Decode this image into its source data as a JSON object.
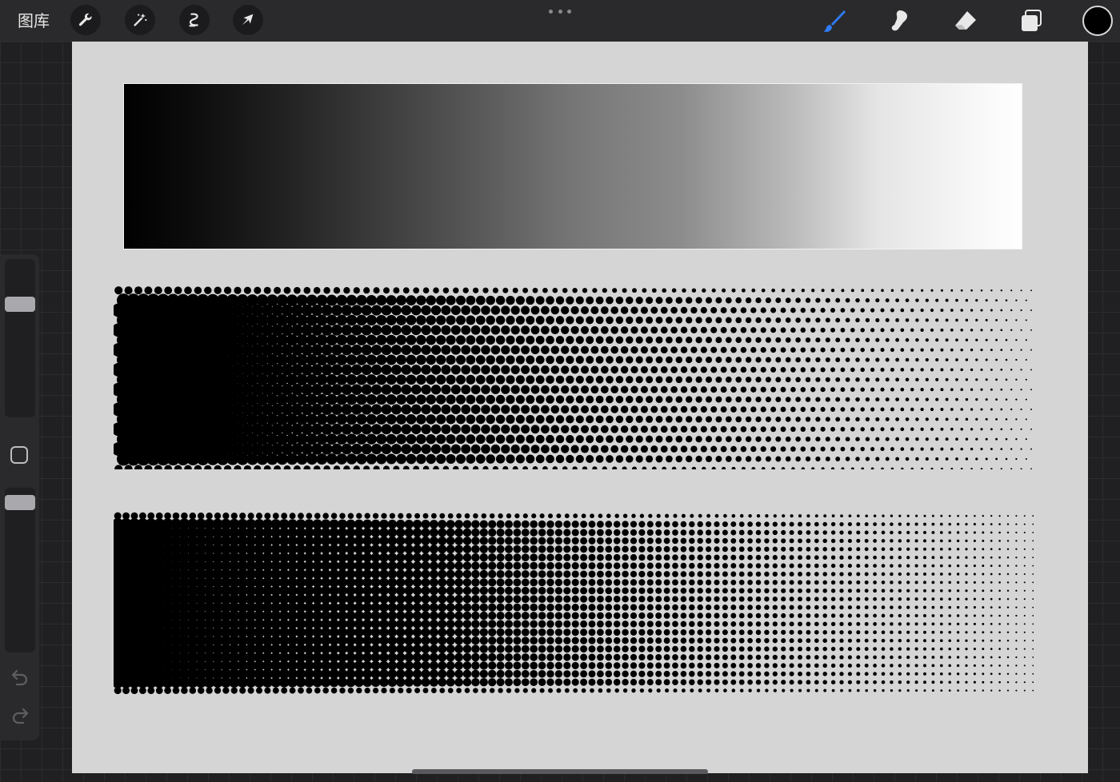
{
  "topbar": {
    "gallery_label": "图库",
    "left_tools": [
      "wrench-icon",
      "magic-wand-icon",
      "selection-icon",
      "transform-arrow-icon"
    ],
    "right_tools": [
      "brush-icon",
      "smudge-icon",
      "eraser-icon",
      "layers-icon"
    ],
    "active_tool": "brush-icon",
    "accent_color": "#2f7cf6",
    "current_color": "#000000"
  },
  "sidebar": {
    "brush_size": 0.74,
    "opacity": 0.95,
    "icons": [
      "undo-icon",
      "redo-icon"
    ]
  },
  "canvas": {
    "background": "#d5d5d5",
    "elements": [
      "grayscale-gradient",
      "halftone-diagonal",
      "halftone-grid"
    ]
  }
}
